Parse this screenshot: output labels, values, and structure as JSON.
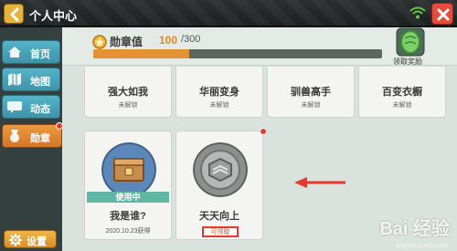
{
  "window": {
    "title": "个人中心"
  },
  "sidebar": {
    "items": [
      {
        "label": "首页",
        "icon": "home-icon"
      },
      {
        "label": "地图",
        "icon": "map-icon"
      },
      {
        "label": "动态",
        "icon": "chat-icon"
      },
      {
        "label": "勋章",
        "icon": "medal-icon"
      }
    ],
    "settings_label": "设置"
  },
  "header": {
    "medal_label": "勋章值",
    "medal_current": "100",
    "medal_max": "/300",
    "progress_fraction": 0.333,
    "reward_label": "领取奖励"
  },
  "medals_top": [
    {
      "name": "强大如我",
      "status": "未解锁"
    },
    {
      "name": "华丽变身",
      "status": "未解锁"
    },
    {
      "name": "驯兽高手",
      "status": "未解锁"
    },
    {
      "name": "百变衣橱",
      "status": "未解锁"
    }
  ],
  "medals_bottom": [
    {
      "name": "我是谁?",
      "badge": "使用中",
      "date": "2020.10.23获得"
    },
    {
      "name": "天天向上",
      "claim": "可领取"
    }
  ],
  "watermark": {
    "text": "Bai 经验",
    "sub": "jingyan.baidu.com"
  },
  "colors": {
    "accent_orange": "#e39234",
    "sidebar_blue": "#4fa9be",
    "highlight_red": "#e8372e"
  }
}
